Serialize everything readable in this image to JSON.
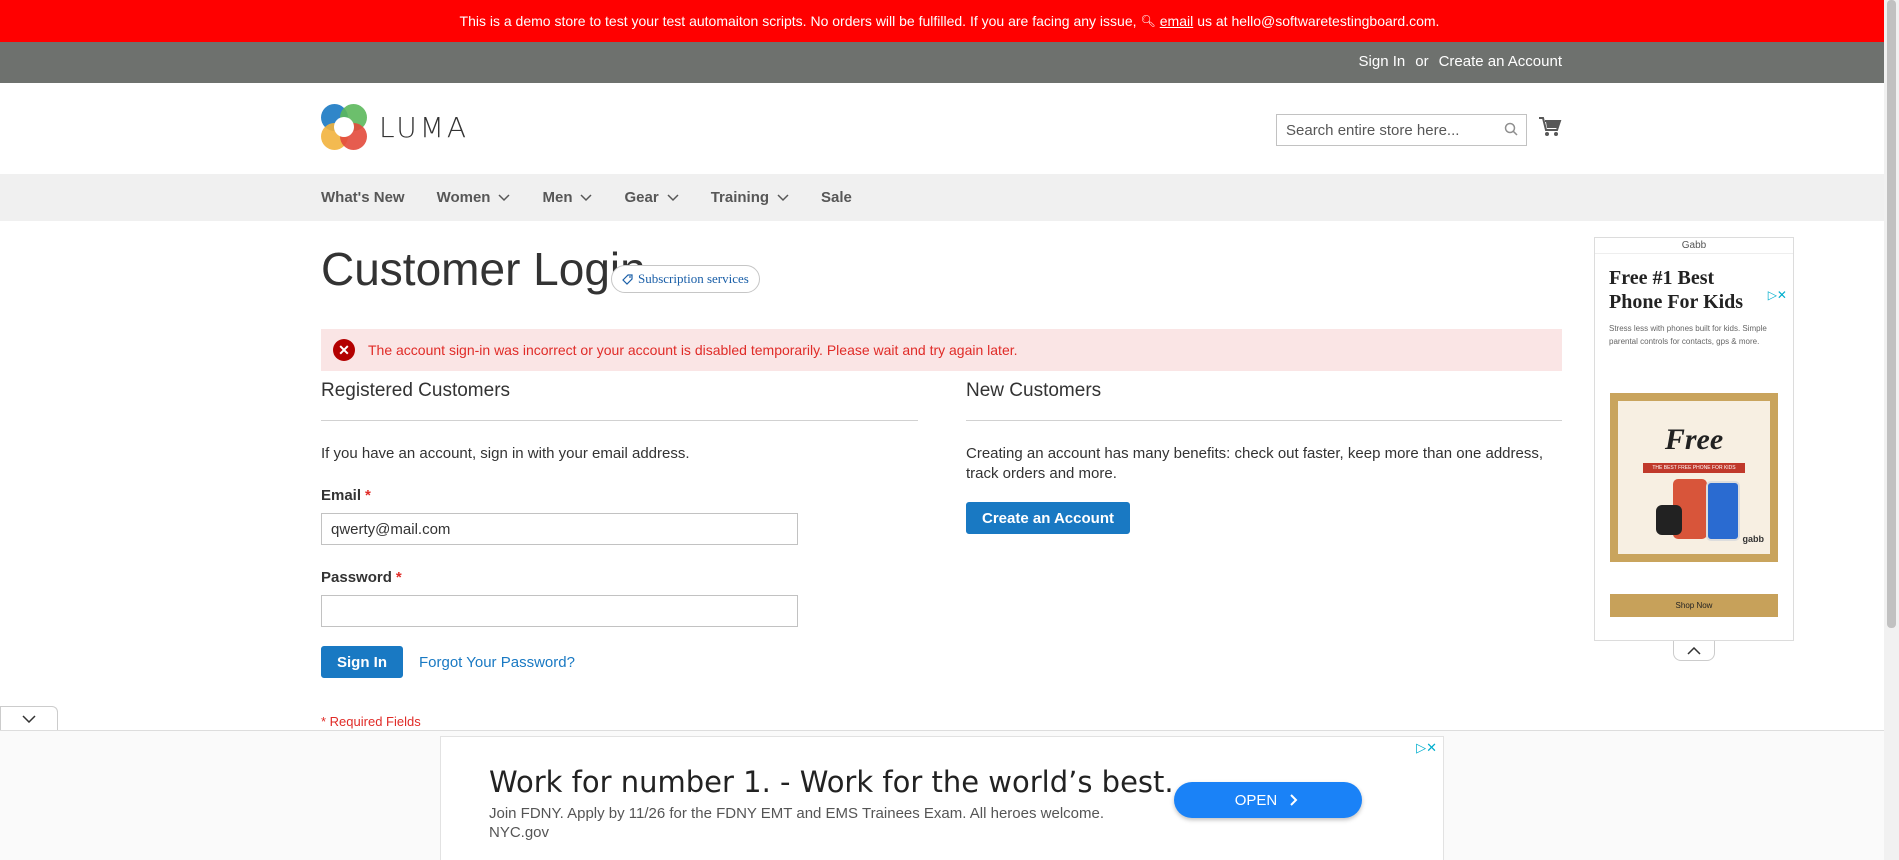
{
  "demo_notice": {
    "text_before": "This is a demo store to test your test automaiton scripts. No orders will be fulfilled. If you are facing any issue,",
    "link": "email",
    "text_after": "us at hello@softwaretestingboard.com."
  },
  "header": {
    "sign_in": "Sign In",
    "or": "or",
    "create_account": "Create an Account"
  },
  "logo": {
    "text": "LUMA"
  },
  "search": {
    "placeholder": "Search entire store here..."
  },
  "nav": {
    "items": [
      {
        "label": "What's New",
        "has_dropdown": false
      },
      {
        "label": "Women",
        "has_dropdown": true
      },
      {
        "label": "Men",
        "has_dropdown": true
      },
      {
        "label": "Gear",
        "has_dropdown": true
      },
      {
        "label": "Training",
        "has_dropdown": true
      },
      {
        "label": "Sale",
        "has_dropdown": false
      }
    ]
  },
  "page": {
    "title": "Customer Login",
    "subscription_badge": "Subscription services"
  },
  "error": {
    "message": "The account sign-in was incorrect or your account is disabled temporarily. Please wait and try again later."
  },
  "registered": {
    "title": "Registered Customers",
    "intro": "If you have an account, sign in with your email address.",
    "email_label": "Email",
    "email_value": "qwerty@mail.com",
    "password_label": "Password",
    "password_value": "",
    "required_mark": "*",
    "sign_in_button": "Sign In",
    "forgot_link": "Forgot Your Password?",
    "required_note": "* Required Fields"
  },
  "new_customers": {
    "title": "New Customers",
    "intro": "Creating an account has many benefits: check out faster, keep more than one address, track orders and more.",
    "create_button": "Create an Account"
  },
  "side_ad": {
    "brand": "Gabb",
    "headline": "Free #1 Best Phone For Kids",
    "body": "Stress less with phones built for kids. Simple parental controls for contacts, gps & more.",
    "image_text": "Free",
    "image_tagline": "THE BEST FREE PHONE FOR KIDS",
    "image_brand": "gabb",
    "cta": "Shop Now"
  },
  "bottom_ad": {
    "title": "Work for number 1. - Work for the world’s best.",
    "description": "Join FDNY. Apply by 11/26 for the FDNY EMT and EMS Trainees Exam. All heroes welcome.",
    "source": "NYC.gov",
    "button": "OPEN"
  },
  "colors": {
    "demo_bar": "#ff0000",
    "header_bar": "#6e716e",
    "primary": "#1979c3",
    "error_text": "#e02b27",
    "error_bg": "#fae5e5"
  }
}
